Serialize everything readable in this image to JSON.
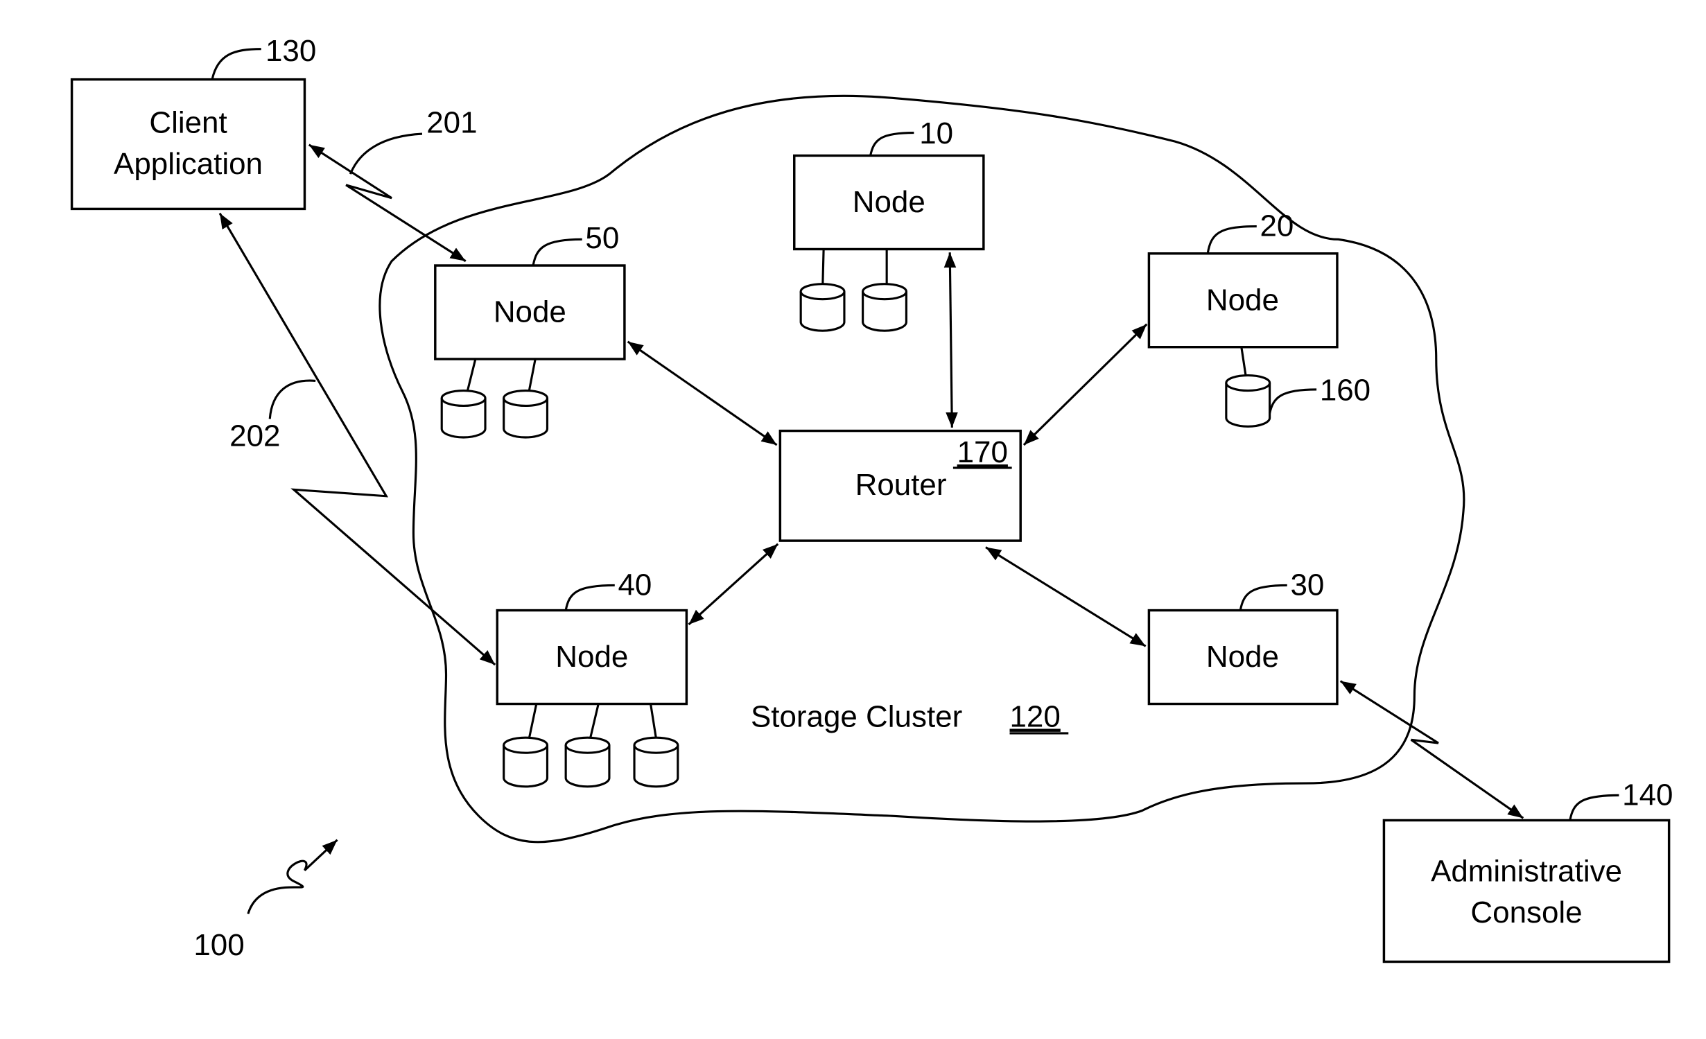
{
  "figure": {
    "system_ref": "100",
    "cluster": {
      "label": "Storage Cluster",
      "ref": "120"
    },
    "client": {
      "line1": "Client",
      "line2": "Application",
      "ref": "130"
    },
    "console": {
      "line1": "Administrative",
      "line2": "Console",
      "ref": "140"
    },
    "router": {
      "label": "Router",
      "ref": "170"
    },
    "nodes": [
      {
        "label": "Node",
        "ref": "10",
        "disks": 2
      },
      {
        "label": "Node",
        "ref": "20",
        "disks": 1
      },
      {
        "label": "Node",
        "ref": "30",
        "disks": 0
      },
      {
        "label": "Node",
        "ref": "40",
        "disks": 3
      },
      {
        "label": "Node",
        "ref": "50",
        "disks": 2
      }
    ],
    "disk_ref": "160",
    "links": {
      "client_to_node50": "201",
      "client_to_node40": "202"
    }
  }
}
